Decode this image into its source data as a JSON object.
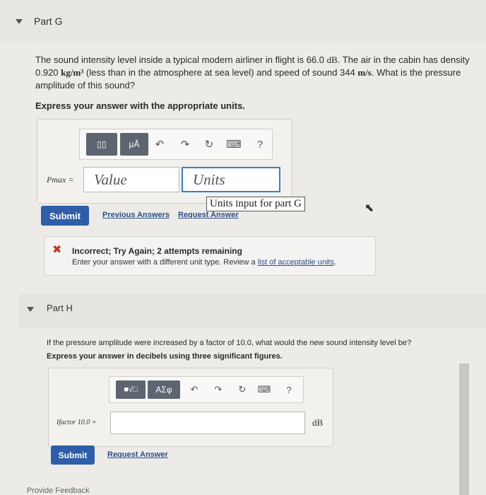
{
  "partG": {
    "title": "Part G",
    "question_line1_a": "The sound intensity level inside a typical modern airliner in flight is 66.0",
    "question_line1_unit": "dB",
    "question_line1_b": ". The air in the cabin has density",
    "question_line2_a": "0.920",
    "question_line2_unit": "kg/m³",
    "question_line2_b": "(less than in the atmosphere at sea level) and speed of sound 344",
    "question_line2_unit2": "m/s",
    "question_line2_c": ". What is the pressure",
    "question_line3": "amplitude of this sound?",
    "instruction": "Express your answer with the appropriate units.",
    "toolbar": {
      "btn1": "▯▯",
      "btn2": "μÅ",
      "undo": "↶",
      "redo": "↷",
      "reset": "↻",
      "keyboard": "⌨",
      "help": "?"
    },
    "variable_label": "Pmax =",
    "value_placeholder": "Value",
    "units_placeholder": "Units",
    "units_tooltip": "Units input for part G",
    "submit": "Submit",
    "previous_answers": "Previous Answers",
    "request_answer": "Request Answer",
    "feedback_title": "Incorrect; Try Again; 2 attempts remaining",
    "feedback_text": "Enter your answer with a different unit type. Review a",
    "feedback_link": "list of acceptable units",
    "feedback_end": "."
  },
  "partH": {
    "title": "Part H",
    "question": "If the pressure amplitude were increased by a factor of 10.0, what would the new sound intensity level be?",
    "instruction": "Express your answer in decibels using three significant figures.",
    "toolbar": {
      "btn1": "■√□",
      "btn2": "ΑΣφ",
      "undo": "↶",
      "redo": "↷",
      "reset": "↻",
      "keyboard": "⌨",
      "help": "?"
    },
    "variable_label": "Ifactor 10.0 =",
    "unit": "dB",
    "submit": "Submit",
    "request_answer": "Request Answer"
  },
  "footer": {
    "provide_feedback": "Provide Feedback"
  }
}
